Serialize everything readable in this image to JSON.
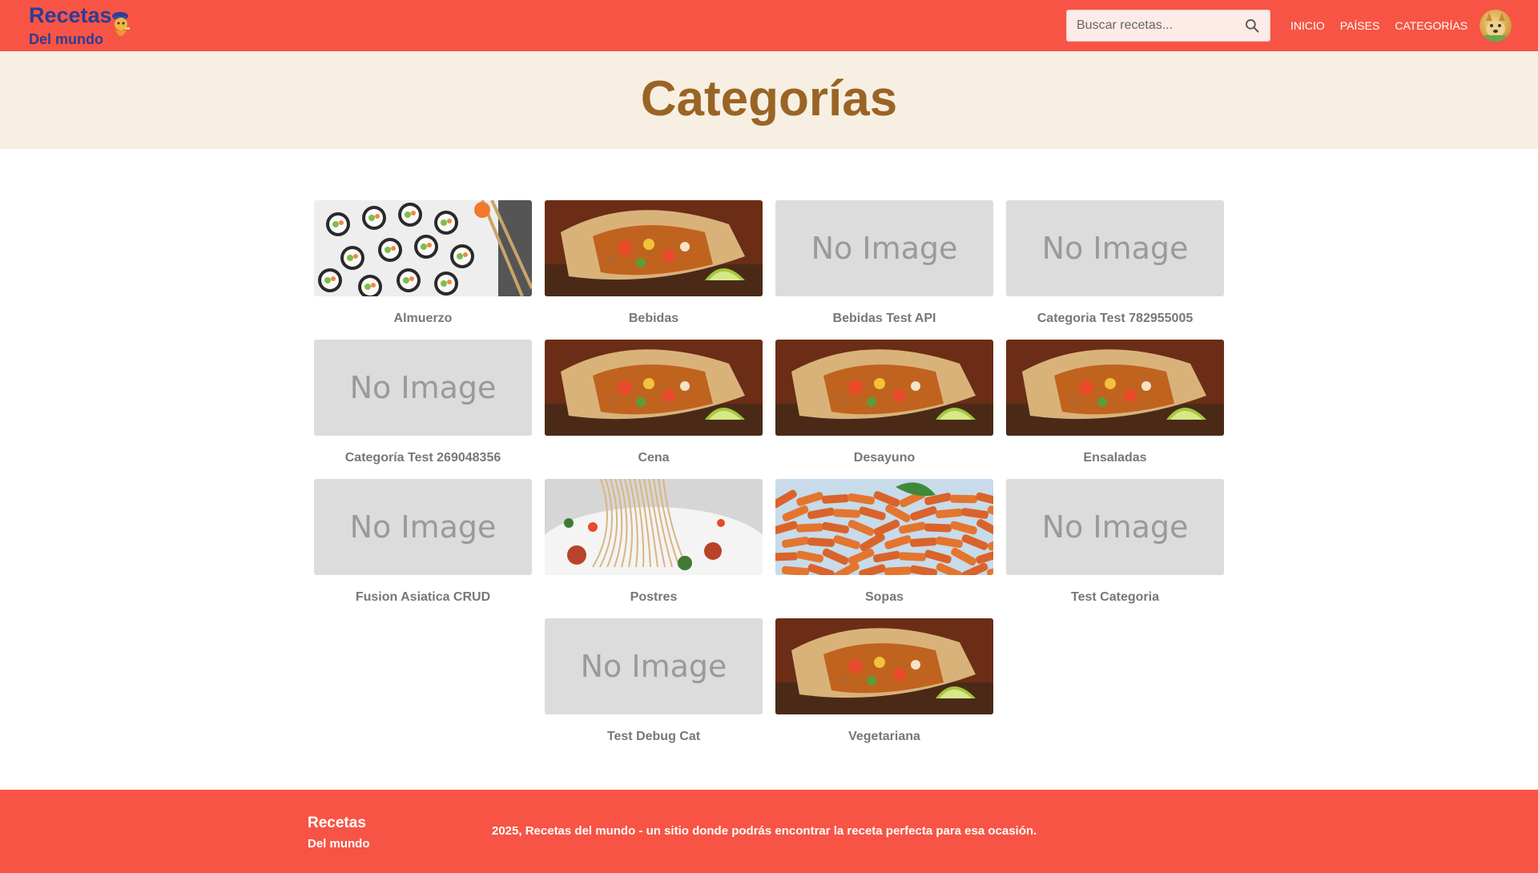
{
  "navbar": {
    "brand_title": "Recetas",
    "brand_sub": "Del mundo",
    "search_placeholder": "Buscar recetas...",
    "links": [
      "INICIO",
      "PAÍSES",
      "CATEGORÍAS"
    ],
    "bg_color": "#f75445",
    "brand_color": "#2d3c96"
  },
  "hero": {
    "title": "Categorías",
    "bg_color": "#f7f0e2",
    "title_color": "#9a6425"
  },
  "categories": [
    {
      "label": "Almuerzo",
      "image": "sushi"
    },
    {
      "label": "Bebidas",
      "image": "burrito"
    },
    {
      "label": "Bebidas Test API",
      "image": "none"
    },
    {
      "label": "Categoria Test 782955005",
      "image": "none"
    },
    {
      "label": "Categoría Test 269048356",
      "image": "none"
    },
    {
      "label": "Cena",
      "image": "burrito"
    },
    {
      "label": "Desayuno",
      "image": "burrito"
    },
    {
      "label": "Ensaladas",
      "image": "burrito"
    },
    {
      "label": "Fusion Asiatica CRUD",
      "image": "none"
    },
    {
      "label": "Postres",
      "image": "pasta"
    },
    {
      "label": "Sopas",
      "image": "penne"
    },
    {
      "label": "Test Categoria",
      "image": "none"
    },
    {
      "label": "Test Debug Cat",
      "image": "none"
    },
    {
      "label": "Vegetariana",
      "image": "burrito"
    }
  ],
  "no_image_text": "No Image",
  "footer": {
    "title": "Recetas",
    "sub": "Del mundo",
    "text": "2025, Recetas del mundo - un sitio donde podrás encontrar la receta perfecta para esa ocasión.",
    "bg_color": "#f75445"
  }
}
